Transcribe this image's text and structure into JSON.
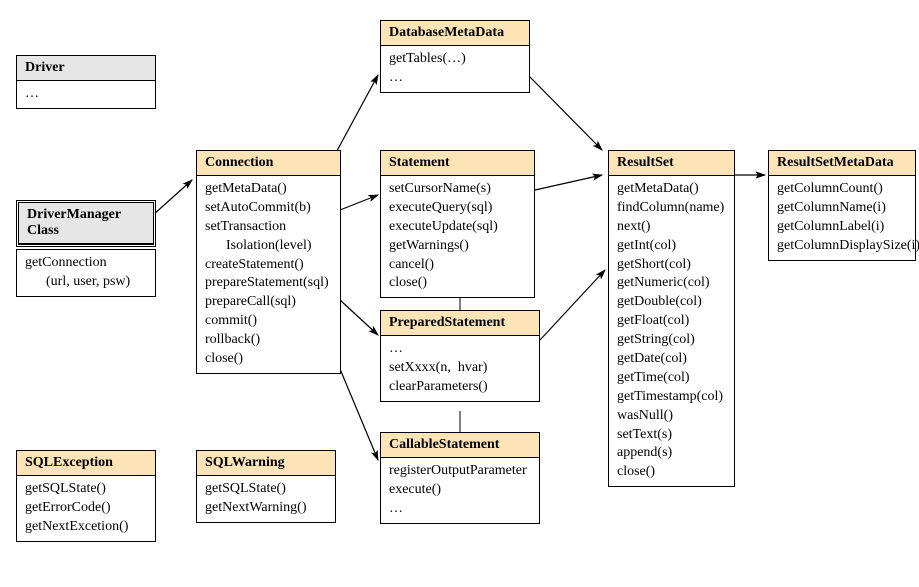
{
  "boxes": {
    "driver": {
      "title": "Driver",
      "lines": [
        "…"
      ]
    },
    "drivermanager": {
      "title": "DriverManager\nClass",
      "lines": [
        "getConnection",
        "      (url, user, psw)"
      ]
    },
    "connection": {
      "title": "Connection",
      "lines": [
        "getMetaData()",
        "setAutoCommit(b)",
        "setTransaction",
        "      Isolation(level)",
        "createStatement()",
        "prepareStatement(sql)",
        "prepareCall(sql)",
        "commit()",
        "rollback()",
        "close()"
      ]
    },
    "databasemetadata": {
      "title": "DatabaseMetaData",
      "lines": [
        "getTables(…)",
        "…"
      ]
    },
    "statement": {
      "title": "Statement",
      "lines": [
        "setCursorName(s)",
        "executeQuery(sql)",
        "executeUpdate(sql)",
        "getWarnings()",
        "cancel()",
        "close()"
      ]
    },
    "preparedstatement": {
      "title": "PreparedStatement",
      "lines": [
        "…",
        "setXxxx(n,  hvar)",
        "clearParameters()"
      ]
    },
    "callablestatement": {
      "title": "CallableStatement",
      "lines": [
        "registerOutputParameter",
        "execute()",
        "…"
      ]
    },
    "resultset": {
      "title": "ResultSet",
      "lines": [
        "getMetaData()",
        "findColumn(name)",
        "next()",
        "getInt(col)",
        "getShort(col)",
        "getNumeric(col)",
        "getDouble(col)",
        "getFloat(col)",
        "getString(col)",
        "getDate(col)",
        "getTime(col)",
        "getTimestamp(col)",
        "wasNull()",
        "setText(s)",
        "append(s)",
        "close()"
      ]
    },
    "resultsetmetadata": {
      "title": "ResultSetMetaData",
      "lines": [
        "getColumnCount()",
        "getColumnName(i)",
        "getColumnLabel(i)",
        "getColumnDisplaySize(i)"
      ]
    },
    "sqlexception": {
      "title": "SQLException",
      "lines": [
        "getSQLState()",
        "getErrorCode()",
        "getNextExcetion()"
      ]
    },
    "sqlwarning": {
      "title": "SQLWarning",
      "lines": [
        "getSQLState()",
        "getNextWarning()"
      ]
    }
  }
}
